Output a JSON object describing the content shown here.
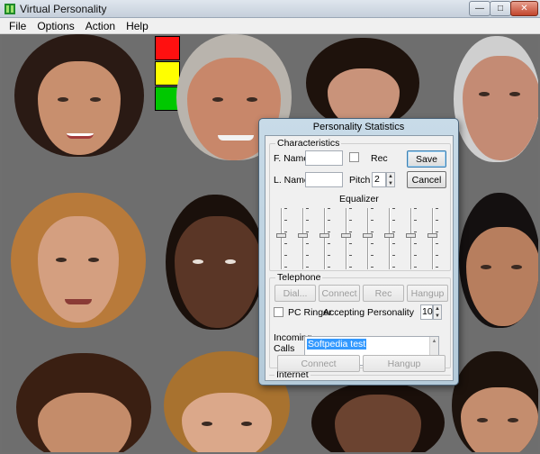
{
  "window": {
    "title": "Virtual Personality",
    "minimize_glyph": "—",
    "maximize_glyph": "□",
    "close_glyph": "✕"
  },
  "menu": [
    "File",
    "Options",
    "Action",
    "Help"
  ],
  "traffic_light": {
    "colors": [
      "#ff1010",
      "#ffff00",
      "#00c800"
    ]
  },
  "dialog": {
    "title": "Personality Statistics",
    "characteristics": {
      "group_label": "Characteristics",
      "first_name_label": "F. Name",
      "first_name_value": "",
      "last_name_label": "L. Name",
      "last_name_value": "",
      "rec_label": "Rec",
      "pitch_label": "Pitch",
      "pitch_value": "2",
      "save_label": "Save",
      "cancel_label": "Cancel",
      "equalizer_label": "Equalizer",
      "equalizer_levels": [
        0.55,
        0.55,
        0.55,
        0.55,
        0.55,
        0.55,
        0.55,
        0.55
      ]
    },
    "telephone": {
      "group_label": "Telephone",
      "dial_label": "Dial...",
      "connect_label": "Connect",
      "rec_label": "Rec",
      "hangup_label": "Hangup",
      "pc_ringer_label": "PC Ringer",
      "accepting_label": "Accepting Personality",
      "accepting_value": "10",
      "incoming_label_1": "Incoming",
      "incoming_label_2": "Calls",
      "incoming_selected": "Softpedia test"
    },
    "internet": {
      "group_label": "Internet",
      "connect_label": "Connect",
      "hangup_label": "Hangup"
    }
  }
}
